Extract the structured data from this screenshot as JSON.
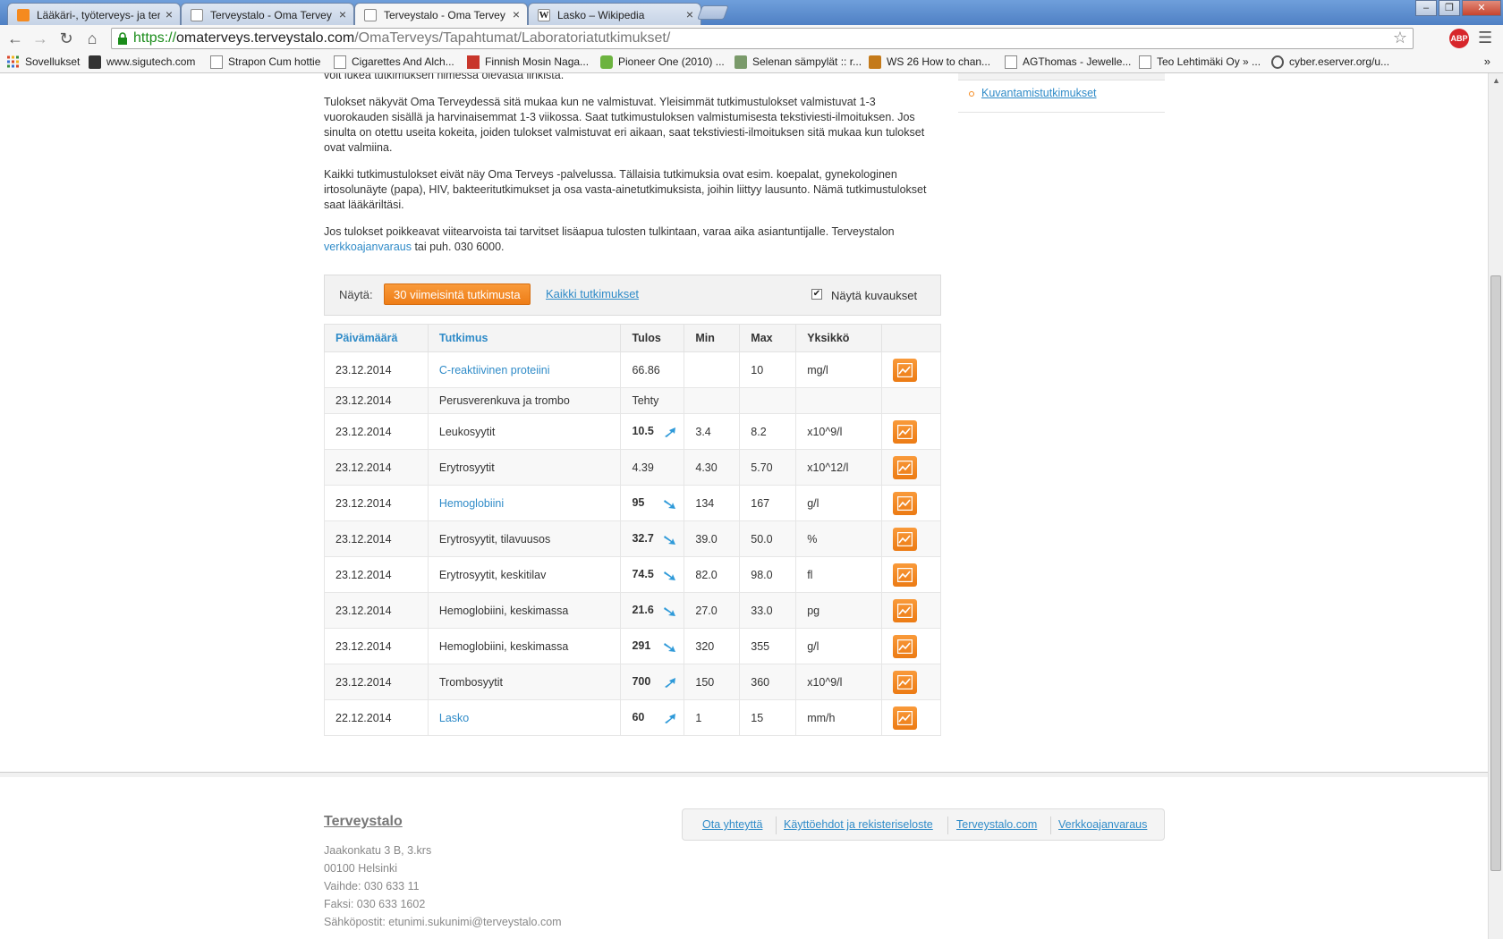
{
  "browser": {
    "tabs": [
      {
        "title": "Lääkäri-, työterveys- ja ter",
        "favicon_color": "#f58a1f"
      },
      {
        "title": "Terveystalo - Oma Tervey",
        "favicon_color": "#ffffff"
      },
      {
        "title": "Terveystalo - Oma Tervey",
        "favicon_color": "#ffffff"
      },
      {
        "title": "Lasko – Wikipedia",
        "favicon_color": "#ffffff"
      }
    ],
    "tab_close": "×",
    "url_https": "https://",
    "url_host": "omaterveys.terveystalo.com",
    "url_path": "/OmaTerveys/Tapahtumat/Laboratoriatutkimukset/",
    "abp_label": "ABP",
    "bookmarks": [
      {
        "label": "Sovellukset"
      },
      {
        "label": "www.sigutech.com"
      },
      {
        "label": "Strapon Cum hottie"
      },
      {
        "label": "Cigarettes And Alch..."
      },
      {
        "label": "Finnish Mosin Naga..."
      },
      {
        "label": "Pioneer One (2010) ..."
      },
      {
        "label": "Selenan sämpylät :: r..."
      },
      {
        "label": "WS 26 How to chan..."
      },
      {
        "label": "AGThomas - Jewelle..."
      },
      {
        "label": "Teo Lehtimäki Oy » ..."
      },
      {
        "label": "cyber.eserver.org/u..."
      }
    ],
    "bookmarks_more": "»"
  },
  "intro": {
    "p0": "voit lukea tutkimuksen nimessä olevasta linkistä.",
    "p1": "Tulokset näkyvät Oma Terveydessä sitä mukaa kun ne valmistuvat. Yleisimmät tutkimustulokset valmistuvat 1-3 vuorokauden sisällä ja harvinaisemmat 1-3 viikossa. Saat tutkimustuloksen valmistumisesta tekstiviesti-ilmoituksen. Jos sinulta on otettu useita kokeita, joiden tulokset valmistuvat eri aikaan, saat tekstiviesti-ilmoituksen sitä mukaa kun tulokset ovat valmiina.",
    "p2": "Kaikki tutkimustulokset eivät näy Oma Terveys -palvelussa. Tällaisia tutkimuksia ovat esim. koepalat, gynekologinen irtosolunäyte (papa), HIV, bakteeritutkimukset ja osa vasta-ainetutkimuksista, joihin liittyy lausunto. Nämä tutkimustulokset saat lääkäriltäsi.",
    "p3_before": "Jos tulokset poikkeavat viitearvoista tai tarvitset lisäapua tulosten tulkintaan, varaa aika asiantuntijalle. Terveystalon ",
    "p3_link": "verkkoajanvaraus",
    "p3_after": " tai puh. 030 6000."
  },
  "sidebar": {
    "link": "Kuvantamistutkimukset"
  },
  "filter": {
    "label": "Näytä:",
    "active": "30 viimeisintä tutkimusta",
    "other": "Kaikki tutkimukset",
    "checkbox_mark": "✔",
    "checkbox_label": "Näytä kuvaukset"
  },
  "table": {
    "headers": {
      "date": "Päivämäärä",
      "test": "Tutkimus",
      "result": "Tulos",
      "min": "Min",
      "max": "Max",
      "unit": "Yksikkö"
    },
    "rows": [
      {
        "date": "23.12.2014",
        "test": "C-reaktiivinen proteiini",
        "result": "66.86",
        "min": "",
        "max": "10",
        "unit": "mg/l"
      },
      {
        "date": "23.12.2014",
        "test": "Perusverenkuva ja trombo",
        "result": "Tehty",
        "min": "",
        "max": "",
        "unit": ""
      },
      {
        "date": "23.12.2014",
        "test": "Leukosyytit",
        "result": "10.5",
        "min": "3.4",
        "max": "8.2",
        "unit": "x10^9/l"
      },
      {
        "date": "23.12.2014",
        "test": "Erytrosyytit",
        "result": "4.39",
        "min": "4.30",
        "max": "5.70",
        "unit": "x10^12/l"
      },
      {
        "date": "23.12.2014",
        "test": "Hemoglobiini",
        "result": "95",
        "min": "134",
        "max": "167",
        "unit": "g/l"
      },
      {
        "date": "23.12.2014",
        "test": "Erytrosyytit, tilavuusos",
        "result": "32.7",
        "min": "39.0",
        "max": "50.0",
        "unit": "%"
      },
      {
        "date": "23.12.2014",
        "test": "Erytrosyytit, keskitilav",
        "result": "74.5",
        "min": "82.0",
        "max": "98.0",
        "unit": "fl"
      },
      {
        "date": "23.12.2014",
        "test": "Hemoglobiini, keskimassa",
        "result": "21.6",
        "min": "27.0",
        "max": "33.0",
        "unit": "pg"
      },
      {
        "date": "23.12.2014",
        "test": "Hemoglobiini, keskimassa",
        "result": "291",
        "min": "320",
        "max": "355",
        "unit": "g/l"
      },
      {
        "date": "23.12.2014",
        "test": "Trombosyytit",
        "result": "700",
        "min": "150",
        "max": "360",
        "unit": "x10^9/l"
      },
      {
        "date": "22.12.2014",
        "test": "Lasko",
        "result": "60",
        "min": "1",
        "max": "15",
        "unit": "mm/h"
      }
    ]
  },
  "footer": {
    "brand": "Terveystalo",
    "addr1": "Jaakonkatu 3 B, 3.krs",
    "addr2": "00100 Helsinki",
    "addr3": "Vaihde: 030 633 11",
    "addr4": "Faksi: 030 633 1602",
    "addr5": "Sähköpostit: etunimi.sukunimi@terveystalo.com",
    "link1": "Ota yhteyttä",
    "link2": "Käyttöehdot ja rekisteriseloste",
    "link3": "Terveystalo.com",
    "link4": "Verkkoajanvaraus"
  },
  "colors": {
    "accent": "#f58a1f",
    "link": "#2f8bc8"
  }
}
